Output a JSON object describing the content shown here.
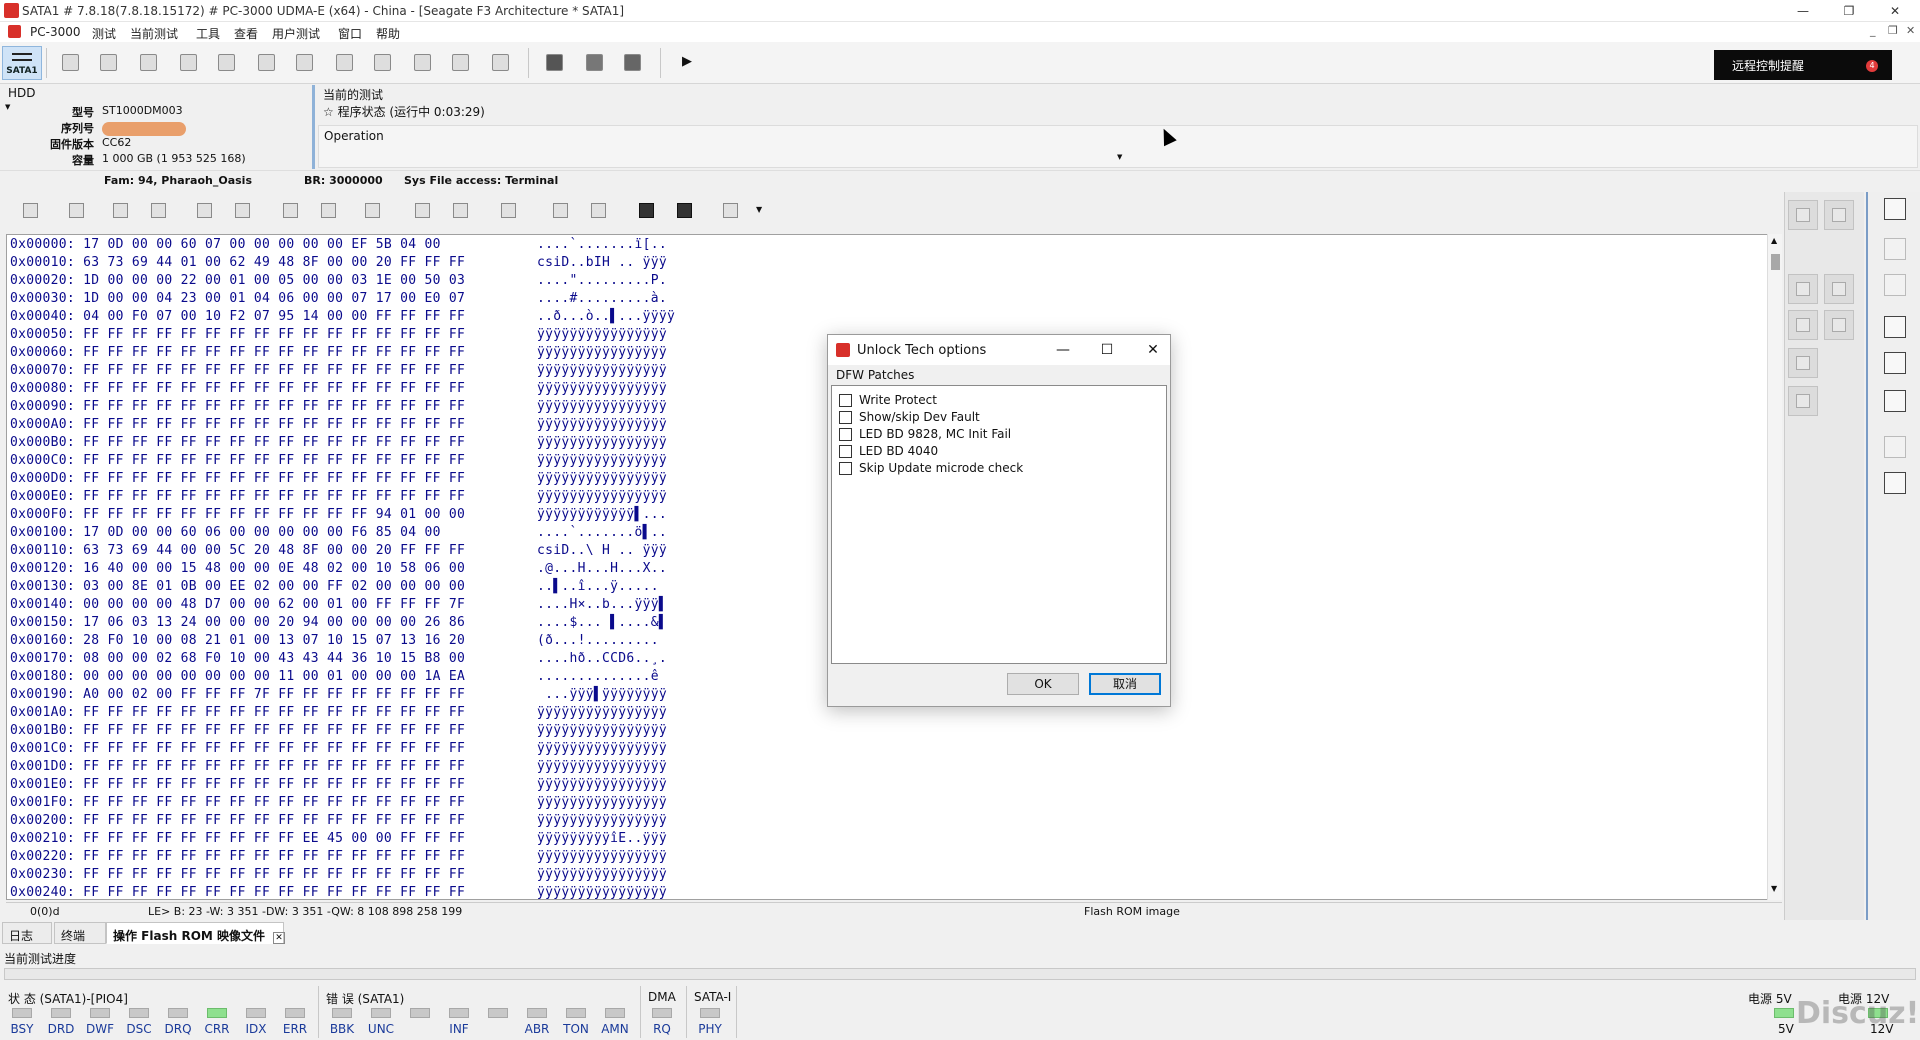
{
  "window": {
    "title": "SATA1 # 7.8.18(7.8.18.15172) # PC-3000 UDMA-E (x64) - China - [Seagate F3 Architecture * SATA1]",
    "minimize": "—",
    "maximize": "❐",
    "close": "✕"
  },
  "menu": [
    "PC-3000",
    "测试",
    "当前测试",
    "工具",
    "查看",
    "用户测试",
    "窗口",
    "帮助"
  ],
  "toolbar": {
    "sata_label": "SATA1",
    "remote_label": "远程控制提醒",
    "remote_badge": "4",
    "run_glyph": "▶"
  },
  "drive": {
    "type_label": "HDD",
    "model_key": "型号",
    "model": "ST1000DM003",
    "serial_key": "序列号",
    "firmware_key": "固件版本",
    "firmware": "CC62",
    "capacity_key": "容量",
    "capacity": "1 000 GB (1 953 525 168)"
  },
  "current_test": {
    "header": "当前的测试",
    "status": "程序状态 (运行中 0:03:29)",
    "operation_label": "Operation"
  },
  "family_bar": {
    "fam": "Fam: 94, Pharaoh_Oasis",
    "br": "BR: 3000000",
    "sysfile": "Sys File access: Terminal"
  },
  "hex": {
    "rows": [
      {
        "addr": "0x00000:",
        "bytes": "17 0D 00 00 60 07 00 00 00 00 00 EF 5B 04 00",
        "ascii": "....`.......ï[.."
      },
      {
        "addr": "0x00010:",
        "bytes": "63 73 69 44 01 00 62 49 48 8F 00 00 20 FF FF FF",
        "ascii": "csiD..bIH .. ÿÿÿ"
      },
      {
        "addr": "0x00020:",
        "bytes": "1D 00 00 00 22 00 01 00 05 00 00 03 1E 00 50 03",
        "ascii": "....\".........P."
      },
      {
        "addr": "0x00030:",
        "bytes": "1D 00 00 04 23 00 01 04 06 00 00 07 17 00 E0 07",
        "ascii": "....#.........à."
      },
      {
        "addr": "0x00040:",
        "bytes": "04 00 F0 07 00 10 F2 07 95 14 00 00 FF FF FF FF",
        "ascii": "..ð...ò..▌...ÿÿÿÿ"
      },
      {
        "addr": "0x00050:",
        "bytes": "FF FF FF FF FF FF FF FF FF FF FF FF FF FF FF FF",
        "ascii": "ÿÿÿÿÿÿÿÿÿÿÿÿÿÿÿÿ"
      },
      {
        "addr": "0x00060:",
        "bytes": "FF FF FF FF FF FF FF FF FF FF FF FF FF FF FF FF",
        "ascii": "ÿÿÿÿÿÿÿÿÿÿÿÿÿÿÿÿ"
      },
      {
        "addr": "0x00070:",
        "bytes": "FF FF FF FF FF FF FF FF FF FF FF FF FF FF FF FF",
        "ascii": "ÿÿÿÿÿÿÿÿÿÿÿÿÿÿÿÿ"
      },
      {
        "addr": "0x00080:",
        "bytes": "FF FF FF FF FF FF FF FF FF FF FF FF FF FF FF FF",
        "ascii": "ÿÿÿÿÿÿÿÿÿÿÿÿÿÿÿÿ"
      },
      {
        "addr": "0x00090:",
        "bytes": "FF FF FF FF FF FF FF FF FF FF FF FF FF FF FF FF",
        "ascii": "ÿÿÿÿÿÿÿÿÿÿÿÿÿÿÿÿ"
      },
      {
        "addr": "0x000A0:",
        "bytes": "FF FF FF FF FF FF FF FF FF FF FF FF FF FF FF FF",
        "ascii": "ÿÿÿÿÿÿÿÿÿÿÿÿÿÿÿÿ"
      },
      {
        "addr": "0x000B0:",
        "bytes": "FF FF FF FF FF FF FF FF FF FF FF FF FF FF FF FF",
        "ascii": "ÿÿÿÿÿÿÿÿÿÿÿÿÿÿÿÿ"
      },
      {
        "addr": "0x000C0:",
        "bytes": "FF FF FF FF FF FF FF FF FF FF FF FF FF FF FF FF",
        "ascii": "ÿÿÿÿÿÿÿÿÿÿÿÿÿÿÿÿ"
      },
      {
        "addr": "0x000D0:",
        "bytes": "FF FF FF FF FF FF FF FF FF FF FF FF FF FF FF FF",
        "ascii": "ÿÿÿÿÿÿÿÿÿÿÿÿÿÿÿÿ"
      },
      {
        "addr": "0x000E0:",
        "bytes": "FF FF FF FF FF FF FF FF FF FF FF FF FF FF FF FF",
        "ascii": "ÿÿÿÿÿÿÿÿÿÿÿÿÿÿÿÿ"
      },
      {
        "addr": "0x000F0:",
        "bytes": "FF FF FF FF FF FF FF FF FF FF FF FF 94 01 00 00",
        "ascii": "ÿÿÿÿÿÿÿÿÿÿÿÿ▌..."
      },
      {
        "addr": "0x00100:",
        "bytes": "17 0D 00 00 60 06 00 00 00 00 00 F6 85 04 00",
        "ascii": "....`.......ö▌.."
      },
      {
        "addr": "0x00110:",
        "bytes": "63 73 69 44 00 00 5C 20 48 8F 00 00 20 FF FF FF",
        "ascii": "csiD..\\ H .. ÿÿÿ"
      },
      {
        "addr": "0x00120:",
        "bytes": "16 40 00 00 15 48 00 00 0E 48 02 00 10 58 06 00",
        "ascii": ".@...H...H...X.."
      },
      {
        "addr": "0x00130:",
        "bytes": "03 00 8E 01 0B 00 EE 02 00 00 FF 02 00 00 00 00",
        "ascii": "..▌..î...ÿ....."
      },
      {
        "addr": "0x00140:",
        "bytes": "00 00 00 00 48 D7 00 00 62 00 01 00 FF FF FF 7F",
        "ascii": "....H×..b...ÿÿÿ▌"
      },
      {
        "addr": "0x00150:",
        "bytes": "17 06 03 13 24 00 00 00 20 94 00 00 00 00 26 86",
        "ascii": "....$... ▌....&▌"
      },
      {
        "addr": "0x00160:",
        "bytes": "28 F0 10 00 08 21 01 00 13 07 10 15 07 13 16 20",
        "ascii": "(ð...!........."
      },
      {
        "addr": "0x00170:",
        "bytes": "08 00 00 02 68 F0 10 00 43 43 44 36 10 15 B8 00",
        "ascii": "....hð..CCD6..¸."
      },
      {
        "addr": "0x00180:",
        "bytes": "00 00 00 00 00 00 00 00 11 00 01 00 00 00 1A EA",
        "ascii": "..............ê"
      },
      {
        "addr": "0x00190:",
        "bytes": "A0 00 02 00 FF FF FF 7F FF FF FF FF FF FF FF FF",
        "ascii": " ...ÿÿÿ▌ÿÿÿÿÿÿÿÿ"
      },
      {
        "addr": "0x001A0:",
        "bytes": "FF FF FF FF FF FF FF FF FF FF FF FF FF FF FF FF",
        "ascii": "ÿÿÿÿÿÿÿÿÿÿÿÿÿÿÿÿ"
      },
      {
        "addr": "0x001B0:",
        "bytes": "FF FF FF FF FF FF FF FF FF FF FF FF FF FF FF FF",
        "ascii": "ÿÿÿÿÿÿÿÿÿÿÿÿÿÿÿÿ"
      },
      {
        "addr": "0x001C0:",
        "bytes": "FF FF FF FF FF FF FF FF FF FF FF FF FF FF FF FF",
        "ascii": "ÿÿÿÿÿÿÿÿÿÿÿÿÿÿÿÿ"
      },
      {
        "addr": "0x001D0:",
        "bytes": "FF FF FF FF FF FF FF FF FF FF FF FF FF FF FF FF",
        "ascii": "ÿÿÿÿÿÿÿÿÿÿÿÿÿÿÿÿ"
      },
      {
        "addr": "0x001E0:",
        "bytes": "FF FF FF FF FF FF FF FF FF FF FF FF FF FF FF FF",
        "ascii": "ÿÿÿÿÿÿÿÿÿÿÿÿÿÿÿÿ"
      },
      {
        "addr": "0x001F0:",
        "bytes": "FF FF FF FF FF FF FF FF FF FF FF FF FF FF FF FF",
        "ascii": "ÿÿÿÿÿÿÿÿÿÿÿÿÿÿÿÿ"
      },
      {
        "addr": "0x00200:",
        "bytes": "FF FF FF FF FF FF FF FF FF FF FF FF FF FF FF FF",
        "ascii": "ÿÿÿÿÿÿÿÿÿÿÿÿÿÿÿÿ"
      },
      {
        "addr": "0x00210:",
        "bytes": "FF FF FF FF FF FF FF FF FF EE 45 00 00 FF FF FF",
        "ascii": "ÿÿÿÿÿÿÿÿÿîE..ÿÿÿ"
      },
      {
        "addr": "0x00220:",
        "bytes": "FF FF FF FF FF FF FF FF FF FF FF FF FF FF FF FF",
        "ascii": "ÿÿÿÿÿÿÿÿÿÿÿÿÿÿÿÿ"
      },
      {
        "addr": "0x00230:",
        "bytes": "FF FF FF FF FF FF FF FF FF FF FF FF FF FF FF FF",
        "ascii": "ÿÿÿÿÿÿÿÿÿÿÿÿÿÿÿÿ"
      },
      {
        "addr": "0x00240:",
        "bytes": "FF FF FF FF FF FF FF FF FF FF FF FF FF FF FF FF",
        "ascii": "ÿÿÿÿÿÿÿÿÿÿÿÿÿÿÿÿ"
      }
    ]
  },
  "hex_status": {
    "pos": "0(0)d",
    "values": "LE> B: 23 -W: 3 351 -DW: 3 351 -QW: 8 108 898 258 199",
    "image_name": "Flash ROM image"
  },
  "tabs": [
    {
      "label": "日志"
    },
    {
      "label": "终端"
    },
    {
      "label": "操作 Flash ROM 映像文件"
    }
  ],
  "progress_label": "当前测试进度",
  "status": {
    "state_group": "状 态 (SATA1)-[PIO4]",
    "error_group": "错 误 (SATA1)",
    "dma_group": "DMA",
    "sata_group": "SATA-I",
    "state_leds": [
      {
        "label": "BSY",
        "on": false
      },
      {
        "label": "DRD",
        "on": false
      },
      {
        "label": "DWF",
        "on": false
      },
      {
        "label": "DSC",
        "on": false
      },
      {
        "label": "DRQ",
        "on": false
      },
      {
        "label": "CRR",
        "on": true
      },
      {
        "label": "IDX",
        "on": false
      },
      {
        "label": "ERR",
        "on": false
      }
    ],
    "error_leds": [
      {
        "label": "BBK",
        "on": false
      },
      {
        "label": "UNC",
        "on": false
      },
      {
        "label": "",
        "on": false
      },
      {
        "label": "INF",
        "on": false
      },
      {
        "label": "",
        "on": false
      },
      {
        "label": "ABR",
        "on": false
      },
      {
        "label": "TON",
        "on": false
      },
      {
        "label": "AMN",
        "on": false
      }
    ],
    "dma_led": "RQ",
    "sata_led": "PHY",
    "power5_label": "电源 5V",
    "power5_value": "5V",
    "power12_label": "电源 12V",
    "power12_value": "12V"
  },
  "dialog": {
    "title": "Unlock Tech options",
    "section": "DFW Patches",
    "options": [
      {
        "label": "Write Protect"
      },
      {
        "label": "Show/skip Dev Fault"
      },
      {
        "label": "LED BD 9828, MC Init Fail"
      },
      {
        "label": "LED BD 4040"
      },
      {
        "label": "Skip Update microde check"
      }
    ],
    "ok": "OK",
    "cancel": "取消"
  },
  "watermark": "Discuz!"
}
